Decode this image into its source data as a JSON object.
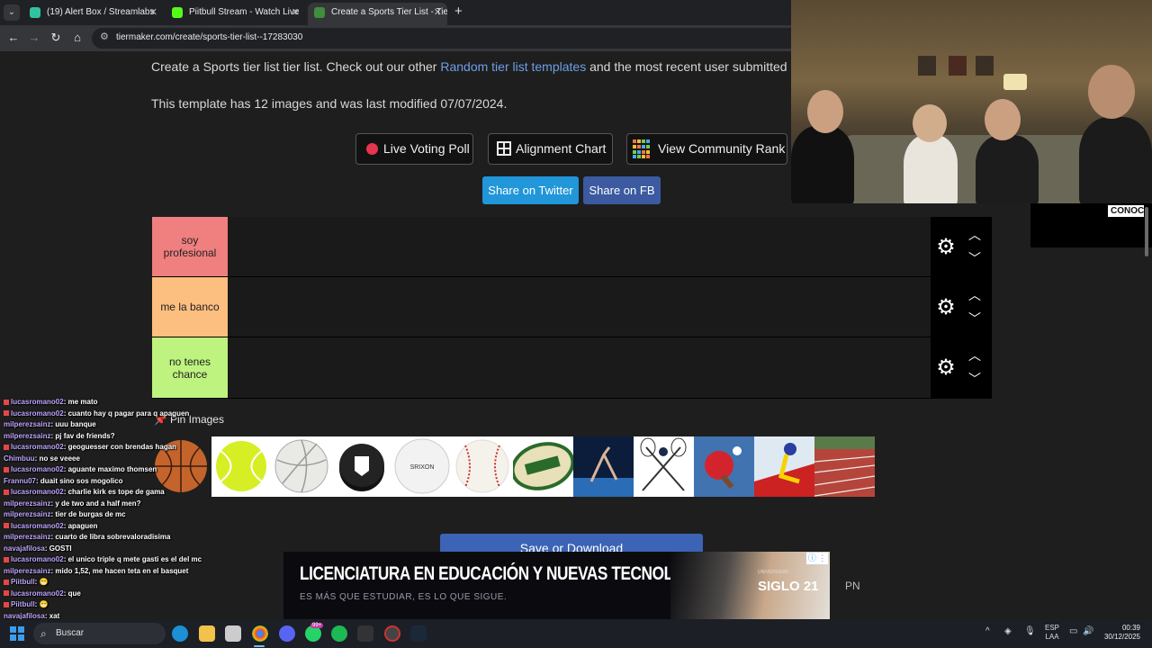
{
  "browser": {
    "tabs": [
      {
        "title": "(19) Alert Box / Streamlabs",
        "active": false,
        "favicon_color": "#31c3a2"
      },
      {
        "title": "Piitbull Stream - Watch Live",
        "active": false,
        "favicon_color": "#53fc18"
      },
      {
        "title": "Create a Sports Tier List - TierM",
        "active": true,
        "favicon_color": "#3d8f3d"
      }
    ],
    "new_tab_icon": "plus-icon",
    "url": "tiermaker.com/create/sports-tier-list--17283030"
  },
  "page": {
    "intro_prefix": "Create a Sports tier list tier list. Check out our other ",
    "intro_link": "Random tier list templates",
    "intro_suffix": " and the most recent user submitted",
    "template_meta": "This template has 12 images and was last modified 07/07/2024.",
    "buttons": {
      "live_voting": "Live Voting Poll",
      "alignment": "Alignment Chart",
      "community_rank": "View Community Rank"
    },
    "share": {
      "twitter": "Share on Twitter",
      "facebook": "Share on FB"
    },
    "tiers": [
      {
        "label": "soy profesional",
        "color": "#f07f7f"
      },
      {
        "label": "me la banco",
        "color": "#fdbf7f"
      },
      {
        "label": "no tenes chance",
        "color": "#bff37f"
      }
    ],
    "pin_images_label": "Pin Images",
    "images": [
      "basketball",
      "tennis-ball",
      "volleyball",
      "hockey-puck",
      "golf-ball",
      "baseball",
      "rugby-ball",
      "gymnast",
      "lacrosse-sticks",
      "ping-pong-paddle",
      "ski-racer",
      "running-track"
    ],
    "save_button": "Save or Download"
  },
  "ad": {
    "headline": "LICENCIATURA EN EDUCACIÓN Y NUEVAS TECNOLOGÍAS",
    "subline": "ES MÁS QUE ESTUDIAR, ES LO QUE SIGUE.",
    "brand": "SIGLO 21",
    "brand_small": "UNIVERSIDAD",
    "badge": "ⓘ ⋮",
    "side_text": "PN"
  },
  "chat": [
    {
      "user": "lucasromano02",
      "msg": "me mato",
      "badge": true
    },
    {
      "user": "lucasromano02",
      "msg": "cuanto hay q pagar para q apaguen",
      "badge": true
    },
    {
      "user": "milperezsainz",
      "msg": "uuu banque",
      "badge": false
    },
    {
      "user": "milperezsainz",
      "msg": "pj fav de friends?",
      "badge": false
    },
    {
      "user": "lucasromano02",
      "msg": "geoguesser con brendas hagan",
      "badge": true
    },
    {
      "user": "Chimbuu",
      "msg": "no se veeee",
      "badge": false
    },
    {
      "user": "lucasromano02",
      "msg": "aguante maximo thomsen",
      "badge": true
    },
    {
      "user": "Frannu07",
      "msg": "duait sino sos mogolico",
      "badge": false
    },
    {
      "user": "lucasromano02",
      "msg": "charlie kirk es tope de gama",
      "badge": true
    },
    {
      "user": "milperezsainz",
      "msg": "y de two and a half men?",
      "badge": false
    },
    {
      "user": "milperezsainz",
      "msg": "tier de burgas de mc",
      "badge": false
    },
    {
      "user": "lucasromano02",
      "msg": "apaguen",
      "badge": true
    },
    {
      "user": "milperezsainz",
      "msg": "cuarto de libra sobrevaloradisima",
      "badge": false
    },
    {
      "user": "navajafilosa",
      "msg": "GOSTI",
      "badge": false
    },
    {
      "user": "lucasromano02",
      "msg": "el unico triple q mete gasti es el del mc",
      "badge": true
    },
    {
      "user": "milperezsainz",
      "msg": "mido 1,52, me hacen teta en el basquet",
      "badge": false
    },
    {
      "user": "Piitbull",
      "msg": "😁",
      "badge": true
    },
    {
      "user": "lucasromano02",
      "msg": "que",
      "badge": true
    },
    {
      "user": "Piitbull",
      "msg": "😁",
      "badge": true
    },
    {
      "user": "navajafilosa",
      "msg": "xat",
      "badge": false
    }
  ],
  "overlay": {
    "side_label": "CONOC"
  },
  "taskbar": {
    "search_placeholder": "Buscar",
    "lang_top": "ESP",
    "lang_bottom": "LAA",
    "time": "00:39",
    "date": "30/12/2025",
    "whatsapp_badge": "99+"
  }
}
